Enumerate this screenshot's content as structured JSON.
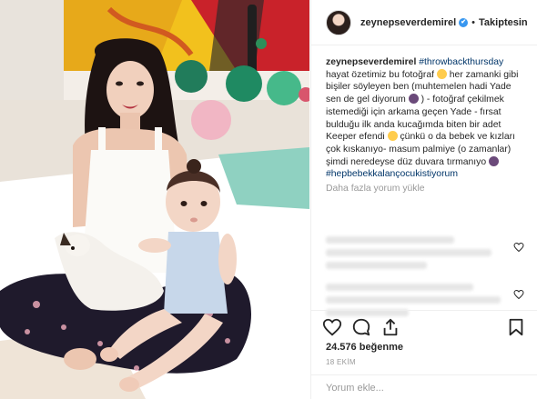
{
  "post": {
    "username": "zeynepseverdemirel",
    "verified_mark": "✔",
    "separator": "•",
    "follow_state": "Takiptesin",
    "caption": {
      "author": "zeynepseverdemirel",
      "hashtag_top": "#throwbackthursday",
      "text_1": "hayat özetimiz bu fotoğraf",
      "text_2": "her zamanki gibi bişiler söyleyen ben (muhtemelen hadi Yade sen de gel diyorum",
      "text_3": ") - fotoğraf çekilmek istemediği için arkama geçen Yade - fırsat bulduğu ilk anda kucağımda biten bir adet Keeper efendi",
      "text_4": "çünkü o da bebek ve kızları çok kıskanıyo- masum palmiye (o zamanlar) şimdi neredeyse düz duvara tırmanıyo",
      "hashtag_bottom": "#hepbebekkalançocukistiyorum"
    },
    "more_comments": "Daha fazla yorum yükle",
    "likes_count": "24.576",
    "likes_label": "beğenme",
    "date": "18 EKİM",
    "comment_placeholder": "Yorum ekle..."
  },
  "icons": {
    "verified": "verified-badge-icon",
    "like": "heart-icon",
    "comment": "comment-bubble-icon",
    "share": "share-icon",
    "save": "bookmark-icon",
    "comment_like": "heart-small-icon"
  },
  "colors": {
    "link": "#003569",
    "verified": "#3897f0",
    "muted": "#999999",
    "border": "#efefef"
  }
}
